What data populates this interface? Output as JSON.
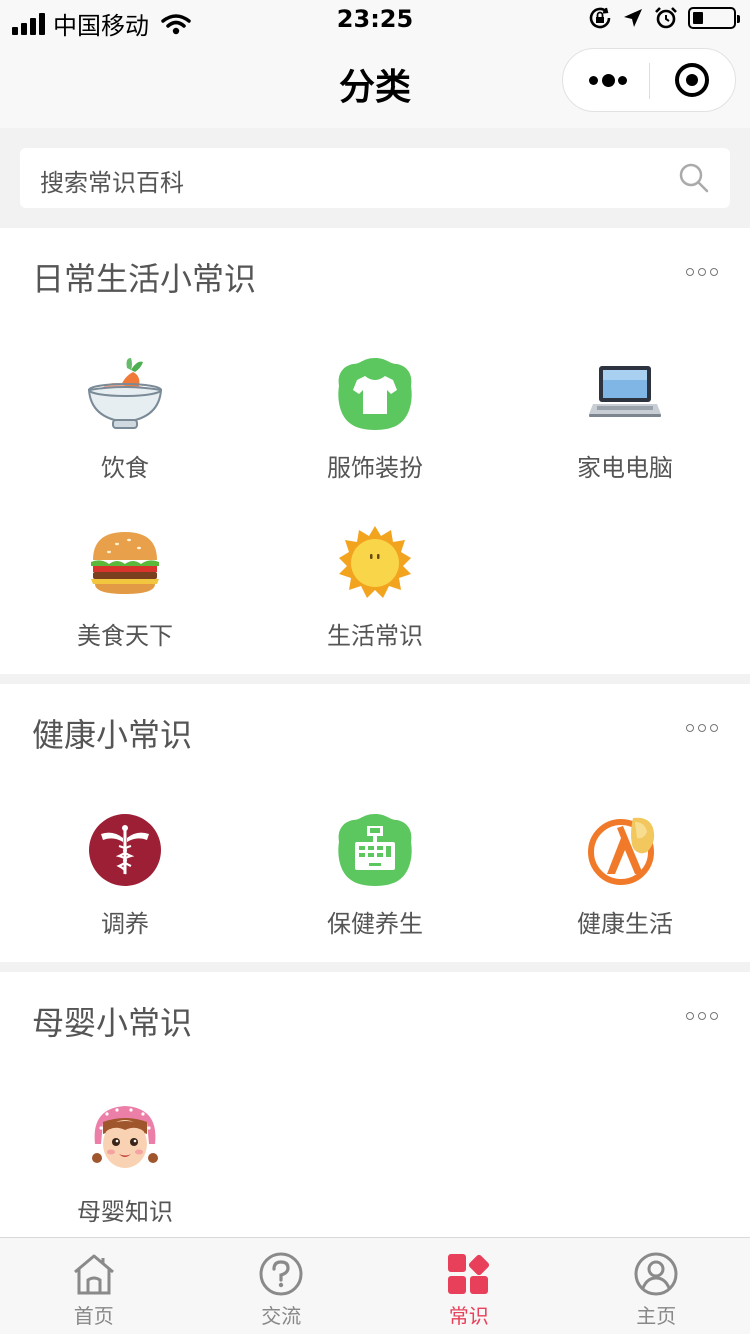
{
  "status_bar": {
    "carrier": "中国移动",
    "time": "23:25",
    "battery_level": 0.25
  },
  "nav": {
    "title": "分类"
  },
  "search": {
    "placeholder": "搜索常识百科"
  },
  "sections": [
    {
      "title": "日常生活小常识",
      "items": [
        {
          "label": "饮食",
          "icon": "food-bowl-icon"
        },
        {
          "label": "服饰装扮",
          "icon": "tshirt-icon"
        },
        {
          "label": "家电电脑",
          "icon": "laptop-icon"
        },
        {
          "label": "美食天下",
          "icon": "burger-icon"
        },
        {
          "label": "生活常识",
          "icon": "sun-icon"
        }
      ]
    },
    {
      "title": "健康小常识",
      "items": [
        {
          "label": "调养",
          "icon": "caduceus-icon"
        },
        {
          "label": "保健养生",
          "icon": "cash-register-icon"
        },
        {
          "label": "健康生活",
          "icon": "lambda-badge-icon"
        }
      ]
    },
    {
      "title": "母婴小常识",
      "items": [
        {
          "label": "母婴知识",
          "icon": "girl-face-icon"
        }
      ]
    }
  ],
  "tabs": [
    {
      "label": "首页",
      "icon": "home-icon",
      "active": false
    },
    {
      "label": "交流",
      "icon": "question-icon",
      "active": false
    },
    {
      "label": "常识",
      "icon": "category-blocks-icon",
      "active": true
    },
    {
      "label": "主页",
      "icon": "profile-icon",
      "active": false
    }
  ],
  "colors": {
    "accent": "#e8405a",
    "page_bg": "#f2f2f2",
    "bar_bg": "#f8f8f8",
    "green_icon": "#5cc75e"
  }
}
